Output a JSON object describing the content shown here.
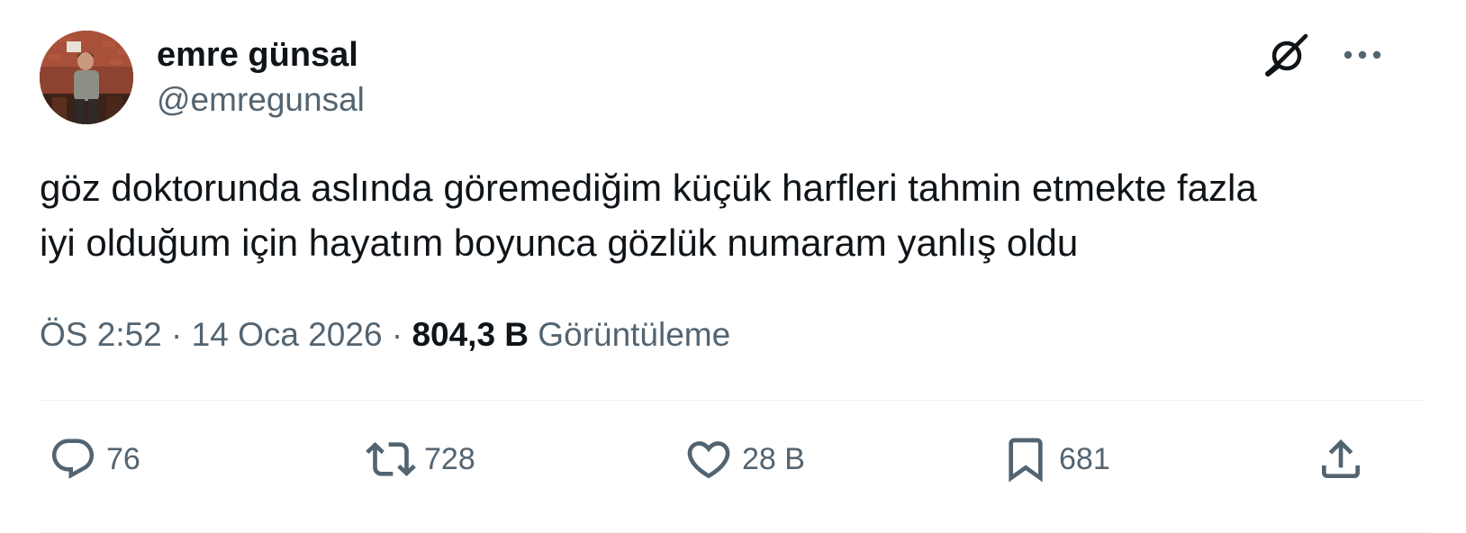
{
  "author": {
    "display_name": "emre günsal",
    "handle": "@emregunsal",
    "avatar_icon": "profile-photo-comedian-on-stage"
  },
  "header_actions": {
    "grok_icon": "grok-icon",
    "more_icon": "more-horizontal-icon"
  },
  "tweet": {
    "text": "göz doktorunda aslında göremediğim küçük harfleri tahmin etmekte fazla\niyi olduğum için hayatım boyunca gözlük numaram yanlış oldu"
  },
  "meta": {
    "time": "ÖS 2:52",
    "separator": " · ",
    "date": "14 Oca 2026",
    "views_count": "804,3 B",
    "views_label": " Görüntüleme"
  },
  "actions": {
    "reply": {
      "icon": "reply-bubble-icon",
      "count": "76"
    },
    "retweet": {
      "icon": "retweet-arrows-icon",
      "count": "728"
    },
    "like": {
      "icon": "heart-icon",
      "count": "28 B"
    },
    "bookmark": {
      "icon": "bookmark-icon",
      "count": "681"
    },
    "share": {
      "icon": "share-upload-icon"
    }
  },
  "colors": {
    "text_primary": "#0f1419",
    "text_secondary": "#536471",
    "divider": "#eff3f4",
    "background": "#ffffff"
  }
}
